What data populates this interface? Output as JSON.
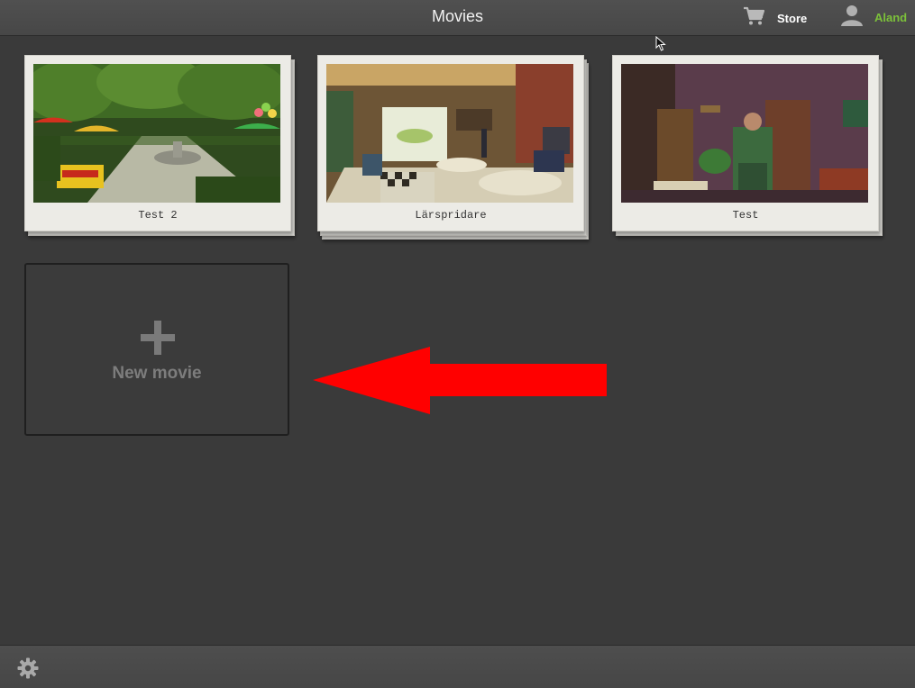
{
  "header": {
    "title": "Movies",
    "store_label": "Store",
    "user_label": "Aland"
  },
  "movies": [
    {
      "label": "Test 2",
      "thumbnail": "park-scene"
    },
    {
      "label": "Lärspridare",
      "thumbnail": "cafe-scene"
    },
    {
      "label": "Test",
      "thumbnail": "living-room-scene"
    }
  ],
  "new_movie": {
    "label": "New movie",
    "icon": "plus-icon"
  },
  "annotation": {
    "color": "#ff0000",
    "points_to": "new-movie-tile"
  },
  "footer": {
    "icon": "gear-icon"
  },
  "colors": {
    "background": "#3a3a3a",
    "user_accent": "#7cc13a",
    "card_paper": "#ecebe6",
    "arrow": "#ff0000"
  }
}
